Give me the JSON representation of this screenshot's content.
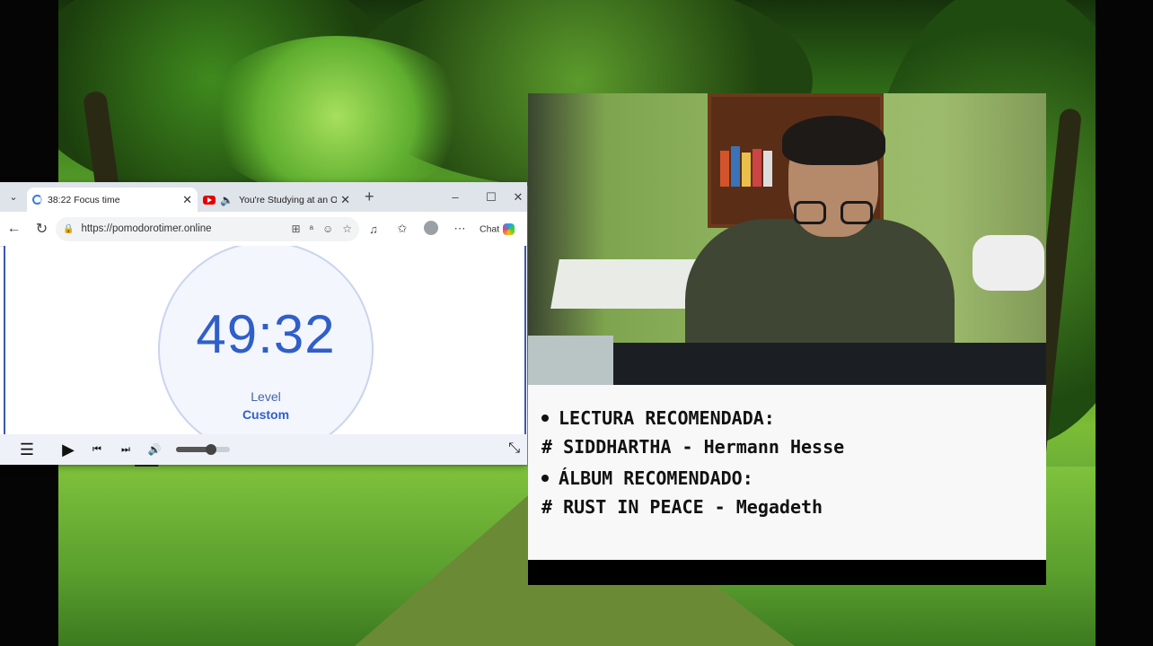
{
  "browser": {
    "tabs": [
      {
        "title": "38:22 Focus time",
        "favicon": "loading-spinner-icon",
        "active": true
      },
      {
        "title": "You're Studying at an O",
        "favicon": "youtube-icon",
        "active": false,
        "audio": "speaker-icon"
      }
    ],
    "new_tab_label": "+",
    "url": "https://pomodorotimer.online",
    "chat_label": "Chat"
  },
  "timer": {
    "time": "49:32",
    "level_label": "Level",
    "level_value": "Custom"
  },
  "player": {
    "volume": 0.65,
    "icons": [
      "menu-icon",
      "play-icon",
      "previous-icon",
      "next-icon",
      "volume-icon",
      "expand-icon"
    ]
  },
  "recommendations": {
    "reading_header": "LECTURA RECOMENDADA:",
    "reading_item": "# SIDDHARTHA - Hermann Hesse",
    "album_header": "ÁLBUM RECOMENDADO:",
    "album_item": "# RUST IN PEACE - Megadeth"
  },
  "colors": {
    "timer_blue": "#2f5fc9",
    "forest_green": "#58a02a"
  }
}
